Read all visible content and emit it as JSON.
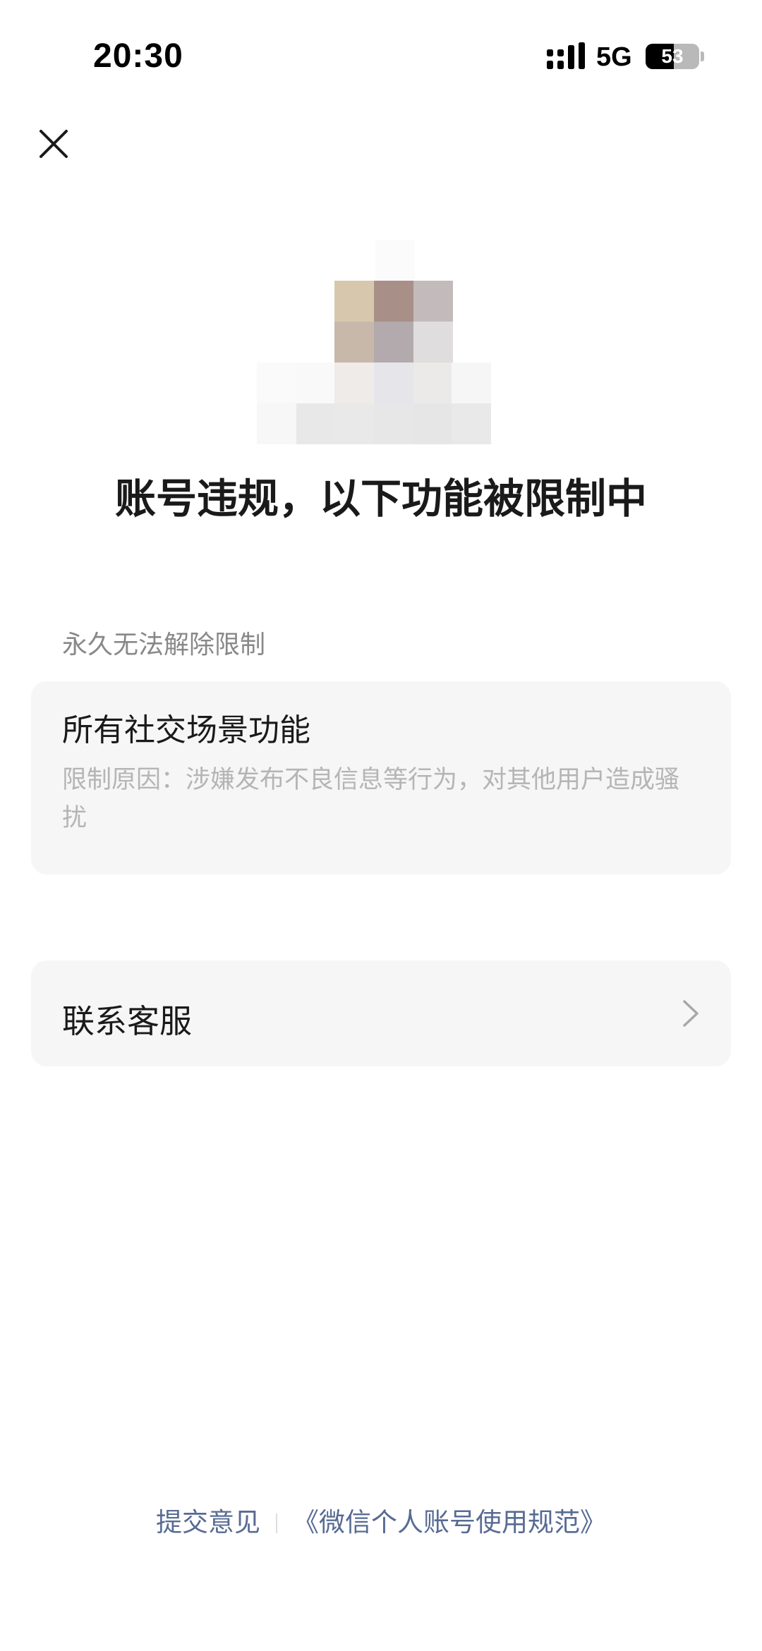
{
  "status_bar": {
    "time": "20:30",
    "network_type": "5G",
    "battery_level": "53",
    "battery_fraction": 0.53,
    "icons": [
      "signal-icon",
      "battery-icon"
    ]
  },
  "header": {
    "close_icon": "close-icon"
  },
  "page": {
    "title": "账号违规，以下功能被限制中"
  },
  "restrictions": {
    "section_label": "永久无法解除限制",
    "items": [
      {
        "name": "所有社交场景功能",
        "reason": "限制原因：涉嫌发布不良信息等行为，对其他用户造成骚扰"
      }
    ]
  },
  "contact": {
    "label": "联系客服",
    "icon": "chevron-right-icon"
  },
  "footer": {
    "feedback_link": "提交意见",
    "policy_link": "《微信个人账号使用规范》"
  },
  "colors": {
    "background": "#ffffff",
    "card_background": "#f6f6f6",
    "title_text": "#1a1a1a",
    "secondary_text": "#888888",
    "reason_text": "#b5b5b5",
    "link_text": "#586b93"
  }
}
